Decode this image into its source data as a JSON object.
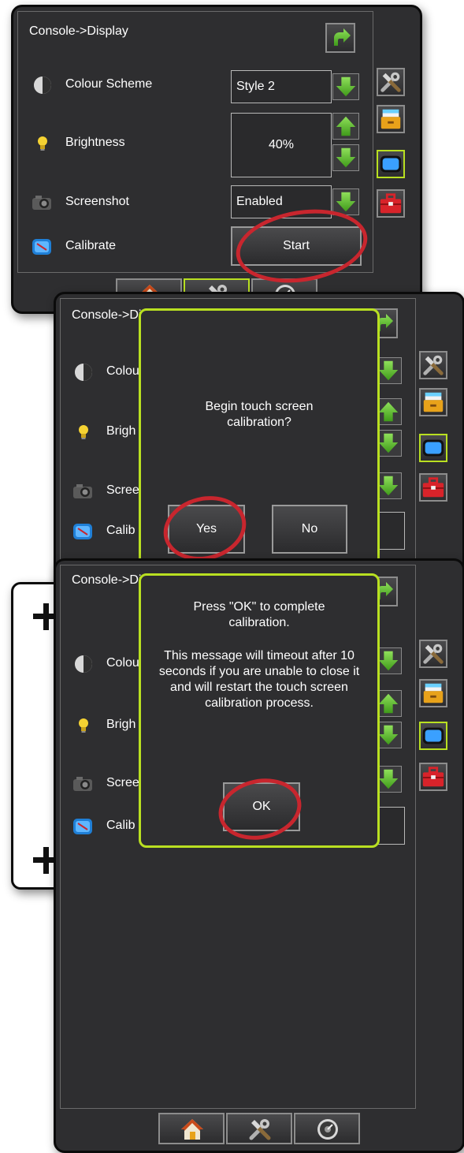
{
  "screen1": {
    "title": "Console->Display",
    "rows": [
      {
        "label": "Colour Scheme",
        "value": "Style 2",
        "icon": "half-circle-icon"
      },
      {
        "label": "Brightness",
        "value": "40%",
        "icon": "bulb-icon"
      },
      {
        "label": "Screenshot",
        "value": "Enabled",
        "icon": "camera-icon"
      },
      {
        "label": "Calibrate",
        "value": "Start",
        "icon": "calibrate-icon"
      }
    ]
  },
  "screen2": {
    "title": "Console->Display",
    "rows": [
      {
        "label": "Colou"
      },
      {
        "label": "Brigh"
      },
      {
        "label": "Scree"
      },
      {
        "label": "Calib"
      }
    ],
    "dialog": {
      "message": "Begin touch screen calibration?",
      "yes_label": "Yes",
      "no_label": "No"
    }
  },
  "screen4": {
    "title": "Console->Display",
    "rows": [
      {
        "label": "Colou"
      },
      {
        "label": "Brigh"
      },
      {
        "label": "Scree"
      },
      {
        "label": "Calib"
      }
    ],
    "dialog": {
      "message1": "Press \"OK\" to complete calibration.",
      "message2": "This message will timeout after 10 seconds if you are unable to close it and will restart the touch screen calibration process.",
      "ok_label": "OK"
    }
  },
  "colors": {
    "panel_bg": "#2e2e30",
    "accent_green": "#b9e021",
    "highlight_red": "#c8262e",
    "arrow_green": "#5cb82a"
  },
  "icons": [
    "back-arrow-icon",
    "tools-icon",
    "storage-icon",
    "display-icon",
    "toolbox-icon",
    "home-icon",
    "speedometer-icon",
    "plus-crosshair-icon"
  ]
}
